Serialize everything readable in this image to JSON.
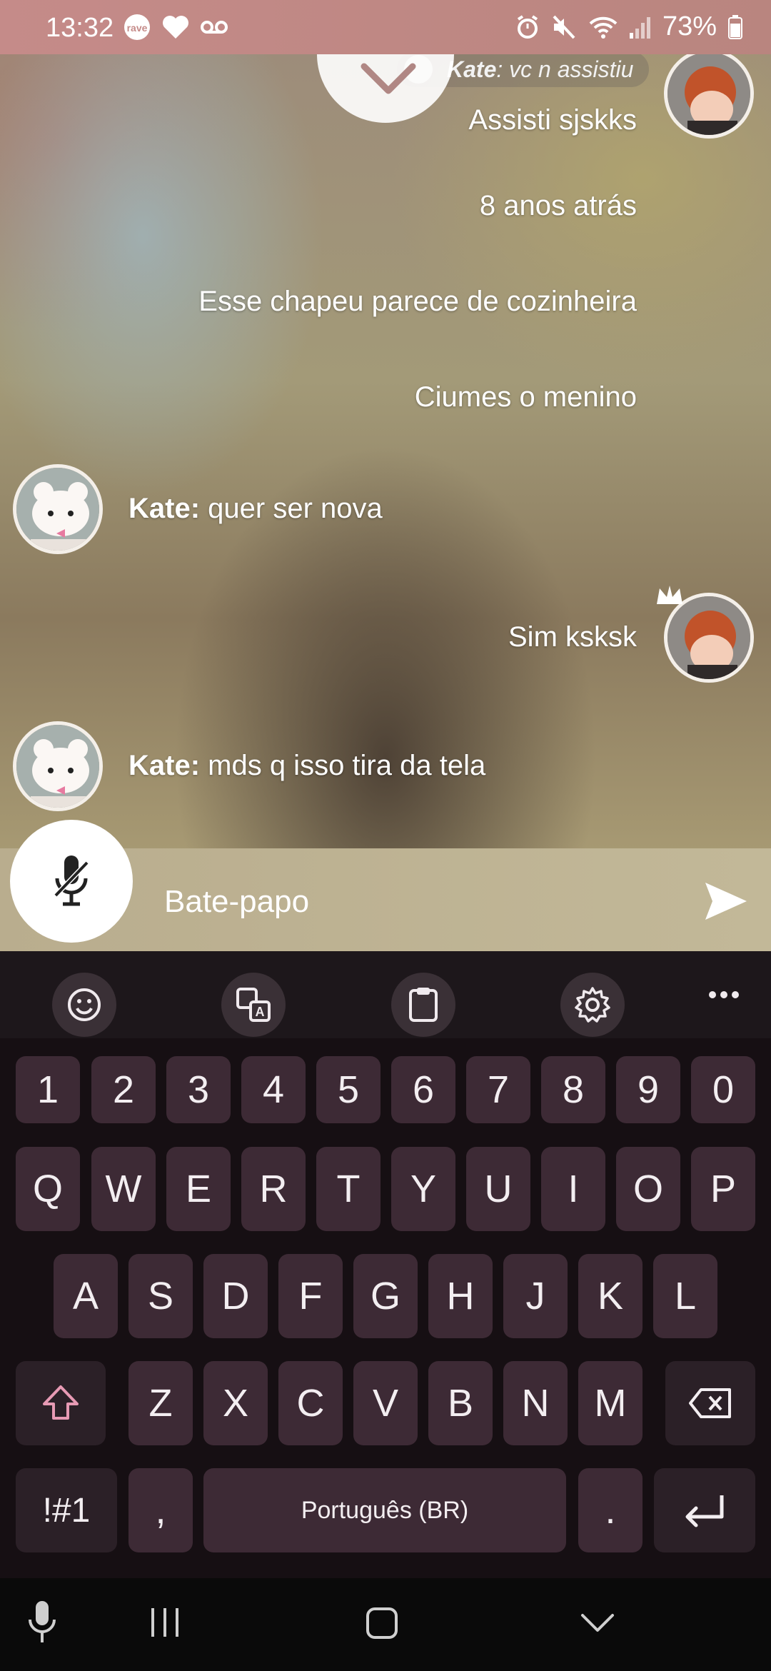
{
  "status_bar": {
    "time": "13:32",
    "battery": "73%",
    "left_icons": [
      "rave-icon",
      "heart-icon",
      "voicemail-icon"
    ],
    "right_icons": [
      "alarm-icon",
      "mute-icon",
      "wifi-icon",
      "signal-icon",
      "battery-icon"
    ]
  },
  "pinned": {
    "sender": "Kate",
    "text": ": vc n assistiu"
  },
  "messages": [
    {
      "side": "right",
      "text": "Assisti sjskks"
    },
    {
      "side": "right",
      "text": "8 anos atrás"
    },
    {
      "side": "right",
      "text": "Esse chapeu parece de cozinheira"
    },
    {
      "side": "right",
      "text": "Ciumes o menino"
    },
    {
      "side": "left",
      "sender": "Kate:",
      "text": " quer ser nova"
    },
    {
      "side": "right",
      "text": "Sim ksksk"
    },
    {
      "side": "left",
      "sender": "Kate:",
      "text": " mds q isso tira da tela"
    }
  ],
  "input": {
    "placeholder": "Bate-papo"
  },
  "keyboard": {
    "toolbar": [
      "emoji-icon",
      "translate-icon",
      "clipboard-icon",
      "settings-icon",
      "more-icon"
    ],
    "row_numbers": [
      "1",
      "2",
      "3",
      "4",
      "5",
      "6",
      "7",
      "8",
      "9",
      "0"
    ],
    "row_1": [
      "Q",
      "W",
      "E",
      "R",
      "T",
      "Y",
      "U",
      "I",
      "O",
      "P"
    ],
    "row_2": [
      "A",
      "S",
      "D",
      "F",
      "G",
      "H",
      "J",
      "K",
      "L"
    ],
    "row_3": [
      "Z",
      "X",
      "C",
      "V",
      "B",
      "N",
      "M"
    ],
    "symbols_label": "!#1",
    "comma_label": ",",
    "space_label": "Português (BR)",
    "period_label": "."
  },
  "colors": {
    "accent_pink": "#e79ab4",
    "key_bg": "#3d2a35",
    "keyboard_bg": "#160f13"
  }
}
